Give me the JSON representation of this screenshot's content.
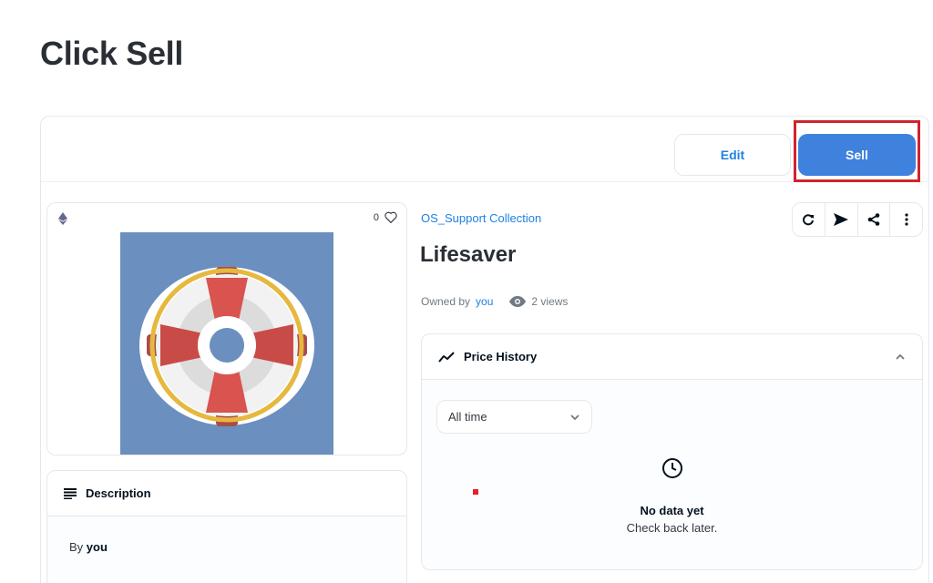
{
  "instruction": {
    "title": "Click Sell"
  },
  "toolbar": {
    "edit_label": "Edit",
    "sell_label": "Sell"
  },
  "item_card": {
    "favorites_count": "0"
  },
  "description": {
    "heading": "Description",
    "by_prefix": "By",
    "by_name": "you"
  },
  "item": {
    "collection": "OS_Support Collection",
    "name": "Lifesaver",
    "owned_by_prefix": "Owned by",
    "owner": "you",
    "views": "2 views"
  },
  "price_history": {
    "heading": "Price History",
    "filter_value": "All time",
    "empty_title": "No data yet",
    "empty_subtitle": "Check back later."
  },
  "colors": {
    "accent": "#2081e2",
    "sell_button": "#3e82dd",
    "highlight": "#d0242d",
    "art_background": "#6b8fbe"
  }
}
